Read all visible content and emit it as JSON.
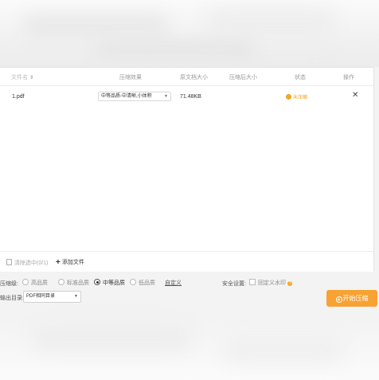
{
  "table": {
    "headers": {
      "filename": "文件名",
      "level": "压缩效果",
      "orig_size": "原文档大小",
      "comp_size": "压缩后大小",
      "status": "状态",
      "action": "操作"
    },
    "rows": [
      {
        "filename": "1.pdf",
        "level": "中等品质-中清晰,小体积",
        "orig_size": "71.48KB",
        "comp_size": "",
        "status": "未压缩"
      }
    ]
  },
  "footer": {
    "clear_label": "清除选中(0/1)",
    "add_label": "添加文件"
  },
  "settings": {
    "compress_label": "压缩级:",
    "options": [
      "高品质",
      "标准品质",
      "中等品质",
      "低品质"
    ],
    "selected_option": "中等品质",
    "custom_label": "自定义",
    "security_label": "安全设置:",
    "checkbox_label": "回定义水印",
    "output_label": "输出目录:",
    "output_value": "PDF相同目录",
    "start_label": "开始压缩"
  },
  "colors": {
    "accent": "#f7a233",
    "status": "#f5a623"
  }
}
